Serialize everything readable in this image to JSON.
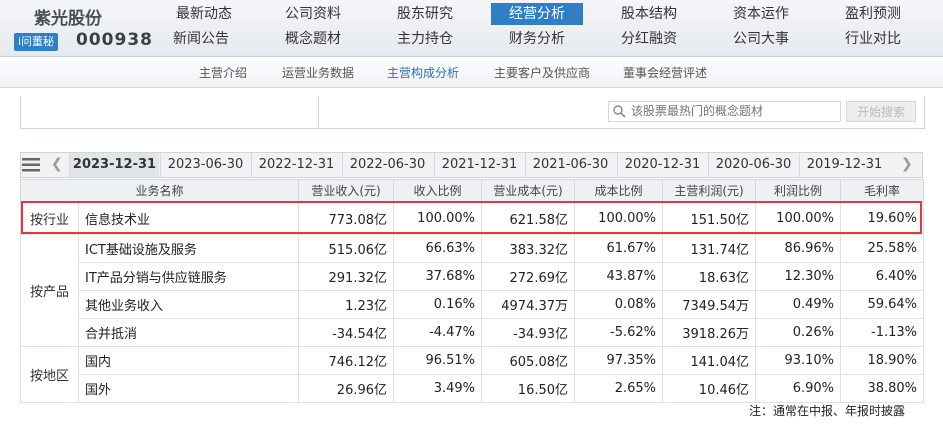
{
  "stock": {
    "name": "紫光股份",
    "ask_badge": "i问董秘",
    "code": "000938"
  },
  "nav": {
    "row1": [
      "最新动态",
      "公司资料",
      "股东研究",
      "经营分析",
      "股本结构",
      "资本运作",
      "盈利预测"
    ],
    "row2": [
      "新闻公告",
      "概念题材",
      "主力持仓",
      "财务分析",
      "分红融资",
      "公司大事",
      "行业对比"
    ],
    "active": "经营分析"
  },
  "subnav": [
    "主营介绍",
    "运营业务数据",
    "主营构成分析",
    "主要客户及供应商",
    "董事会经营评述"
  ],
  "subnav_active": "主营构成分析",
  "search": {
    "placeholder": "该股票最热门的概念题材",
    "button": "开始搜索"
  },
  "date_tabs": [
    "2023-12-31",
    "2023-06-30",
    "2022-12-31",
    "2022-06-30",
    "2021-12-31",
    "2021-06-30",
    "2020-12-31",
    "2020-06-30",
    "2019-12-31"
  ],
  "table": {
    "headers": [
      "业务名称",
      "营业收入(元)",
      "收入比例",
      "营业成本(元)",
      "成本比例",
      "主营利润(元)",
      "利润比例",
      "毛利率"
    ],
    "groups": [
      {
        "label": "按行业",
        "rows": [
          [
            "信息技术业",
            "773.08亿",
            "100.00%",
            "621.58亿",
            "100.00%",
            "151.50亿",
            "100.00%",
            "19.60%"
          ]
        ]
      },
      {
        "label": "按产品",
        "rows": [
          [
            "ICT基础设施及服务",
            "515.06亿",
            "66.63%",
            "383.32亿",
            "61.67%",
            "131.74亿",
            "86.96%",
            "25.58%"
          ],
          [
            "IT产品分销与供应链服务",
            "291.32亿",
            "37.68%",
            "272.69亿",
            "43.87%",
            "18.63亿",
            "12.30%",
            "6.40%"
          ],
          [
            "其他业务收入",
            "1.23亿",
            "0.16%",
            "4974.37万",
            "0.08%",
            "7349.54万",
            "0.49%",
            "59.64%"
          ],
          [
            "合并抵消",
            "-34.54亿",
            "-4.47%",
            "-34.93亿",
            "-5.62%",
            "3918.26万",
            "0.26%",
            "-1.13%"
          ]
        ]
      },
      {
        "label": "按地区",
        "rows": [
          [
            "国内",
            "746.12亿",
            "96.51%",
            "605.08亿",
            "97.35%",
            "141.04亿",
            "93.10%",
            "18.90%"
          ],
          [
            "国外",
            "26.96亿",
            "3.49%",
            "16.50亿",
            "2.65%",
            "10.46亿",
            "6.90%",
            "38.80%"
          ]
        ]
      }
    ]
  },
  "footnote": "注：通常在中报、年报时披露",
  "colors": {
    "accent": "#2f7fc6",
    "highlight_border": "#e0383e"
  }
}
